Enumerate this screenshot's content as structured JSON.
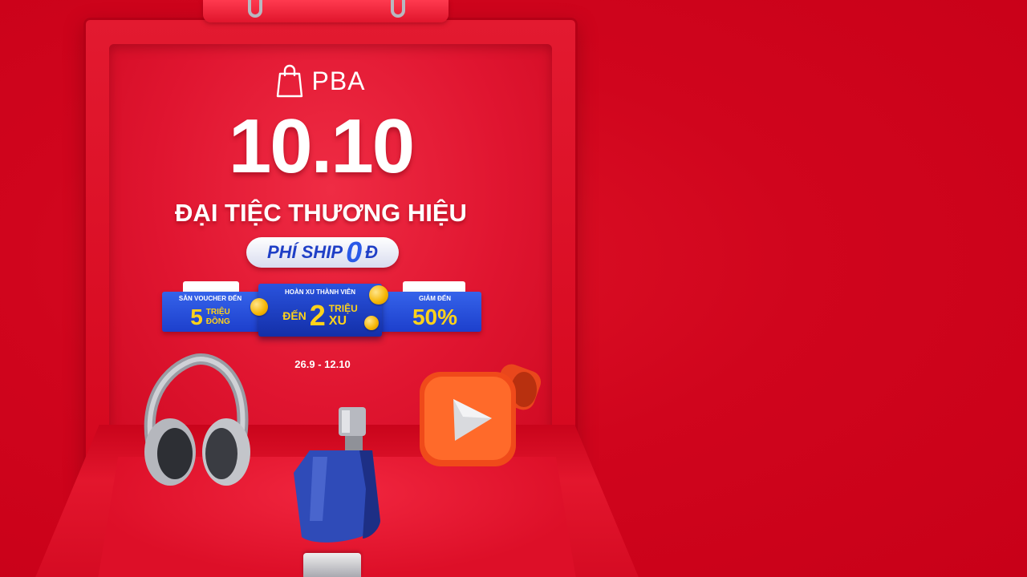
{
  "brand": {
    "name": "PBA",
    "icon": "shopping-bag-icon"
  },
  "headline": {
    "title": "10.10",
    "subtitle": "ĐẠI TIỆC THƯƠNG HIỆU"
  },
  "shipping": {
    "label": "PHÍ SHIP",
    "zero": "0",
    "currency": "Đ"
  },
  "promos": {
    "voucher": {
      "label": "SĂN VOUCHER ĐẾN",
      "number": "5",
      "unit_top": "TRIỆU",
      "unit_bottom": "ĐỒNG"
    },
    "coins": {
      "label": "HOÀN XU THÀNH VIÊN",
      "prefix": "ĐẾN",
      "number": "2",
      "unit_top": "TRIỆU",
      "unit_bottom": "XU"
    },
    "discount": {
      "label": "GIẢM ĐẾN",
      "value": "50%"
    }
  },
  "dates": "26.9 - 12.10",
  "products": [
    "headphones-icon",
    "perfume-bottle-icon",
    "play-button-icon"
  ],
  "colors": {
    "background": "#d0051d",
    "band_blue": "#1d3fcc",
    "accent_yellow": "#ffd21a"
  }
}
